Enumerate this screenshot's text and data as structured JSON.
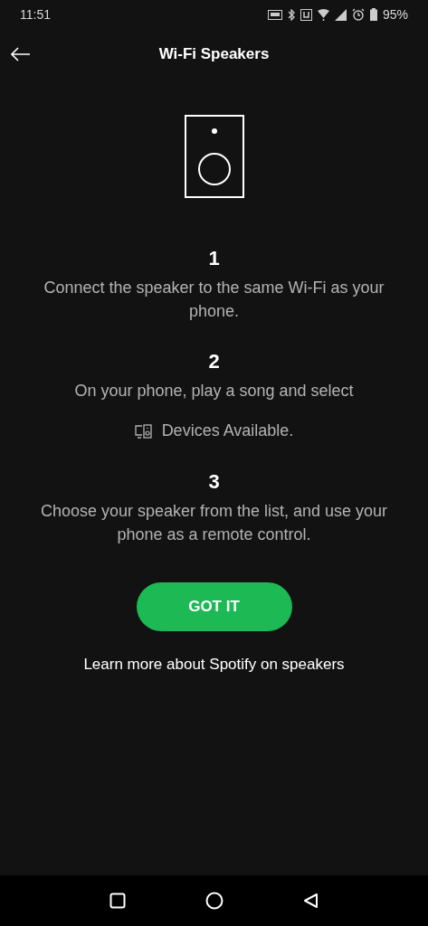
{
  "status_bar": {
    "time": "11:51",
    "battery": "95%"
  },
  "header": {
    "title": "Wi-Fi Speakers"
  },
  "steps": [
    {
      "kind": "plain",
      "number": "1",
      "text": "Connect the speaker to the same Wi-Fi as your phone."
    },
    {
      "kind": "devices",
      "number": "2",
      "text": "On your phone, play a song and select",
      "devices_label": "Devices Available."
    },
    {
      "kind": "plain",
      "number": "3",
      "text": "Choose your speaker from the list, and use your phone as a remote control."
    }
  ],
  "button": {
    "label": "GOT IT"
  },
  "link": {
    "label": "Learn more about Spotify on speakers"
  }
}
